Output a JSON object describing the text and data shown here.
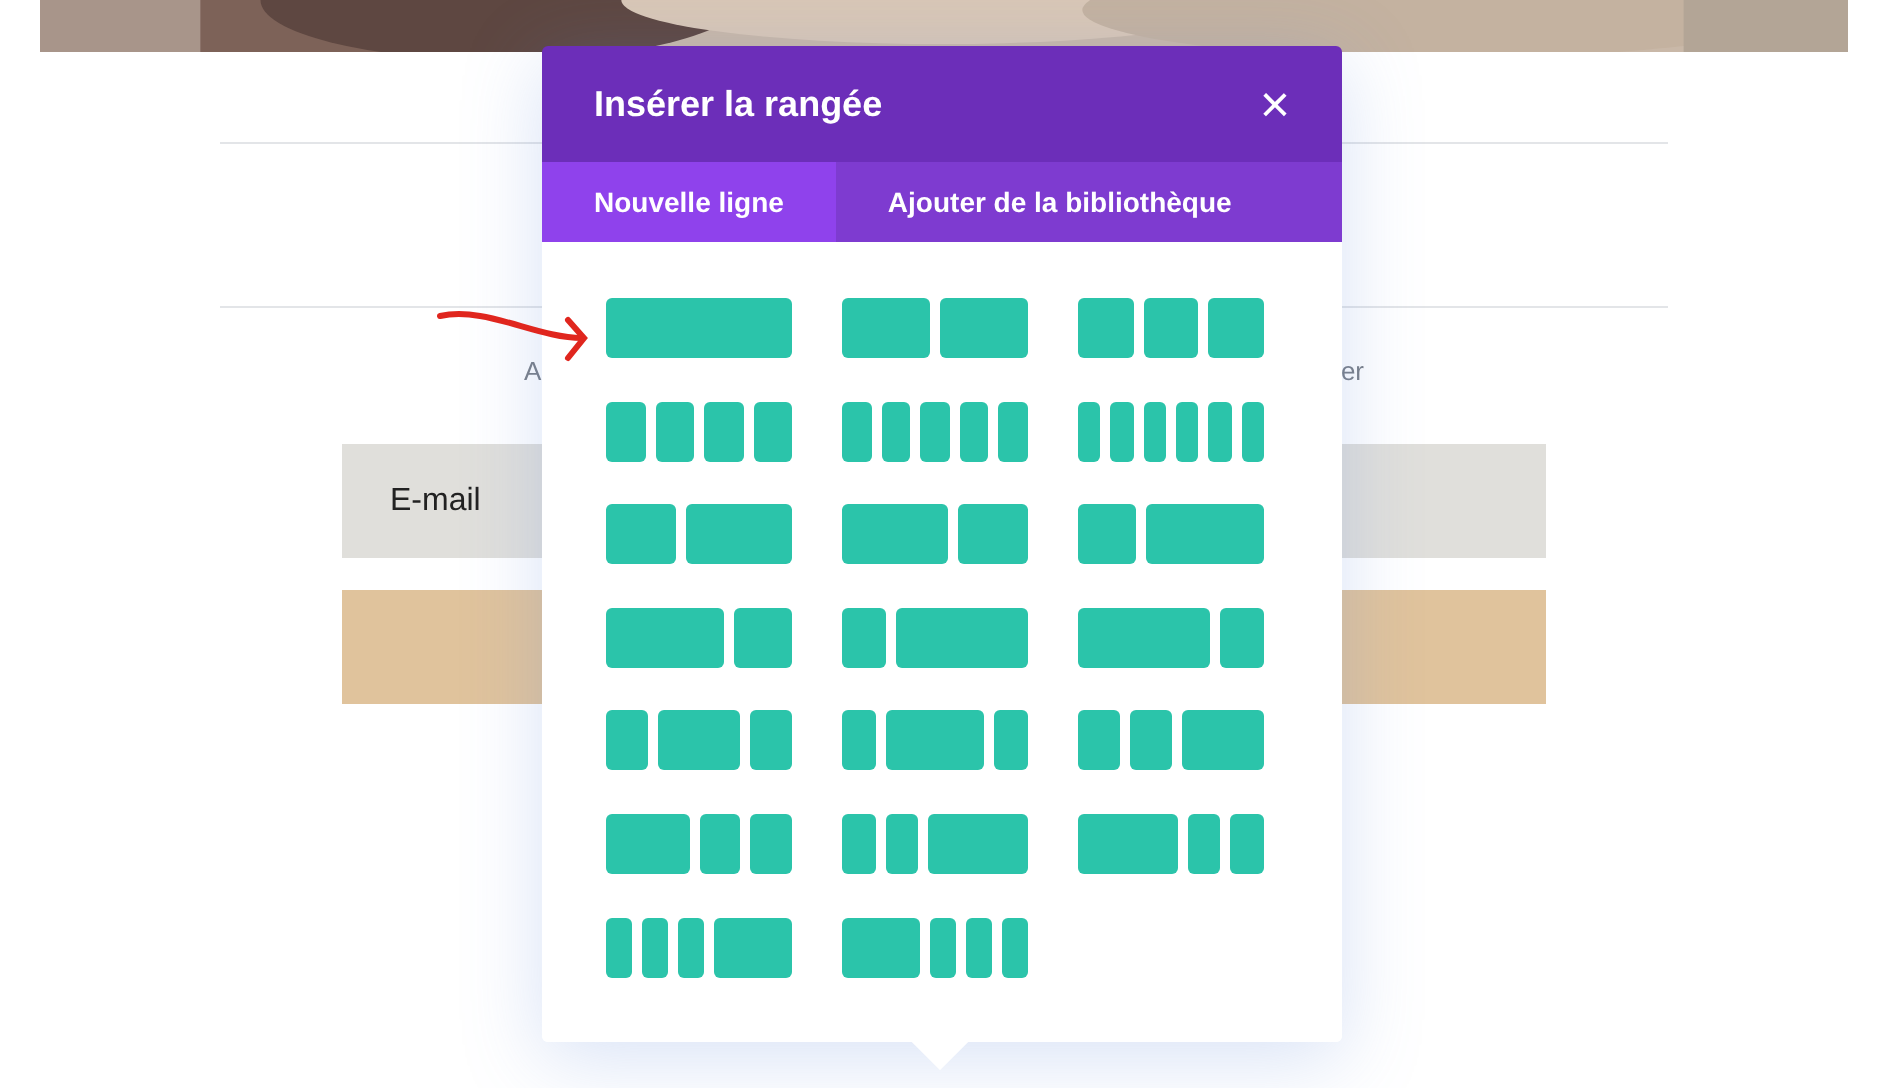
{
  "page": {
    "texts": [
      "A",
      "er"
    ],
    "email_field": {
      "placeholder": "E-mail"
    },
    "submit_button": {
      "kind": "button"
    }
  },
  "dialog": {
    "title": "Insérer la rangée",
    "close": "×",
    "tabs": [
      {
        "label": "Nouvelle ligne",
        "selected": true
      },
      {
        "label": "Ajouter de la bibliothèque",
        "selected": false
      }
    ],
    "layouts": [
      {
        "kind": "full"
      },
      {
        "kind": "halves"
      },
      {
        "kind": "thirds"
      },
      {
        "kind": "quarters"
      },
      {
        "kind": "fifths"
      },
      {
        "kind": "sixths"
      },
      {
        "kind": "twoFifthsThreeFifths"
      },
      {
        "kind": "threeFifthsTwoFifths"
      },
      {
        "kind": "thirdTwoThirds"
      },
      {
        "kind": "twoThirdsThird"
      },
      {
        "kind": "quarterThreeQuarters"
      },
      {
        "kind": "threeQuartersQuarter"
      },
      {
        "kind": "quarterHalfQuarter"
      },
      {
        "kind": "fifthThreeFifthsFifth"
      },
      {
        "kind": "quarterQuarterHalf"
      },
      {
        "kind": "halfQuarterQuarter"
      },
      {
        "kind": "fifthFifthThreeFifths"
      },
      {
        "kind": "threeFifthsFifthFifth"
      },
      {
        "kind": "sixthSixthSixthHalf"
      },
      {
        "kind": "halfSixthSixthSixth"
      }
    ]
  }
}
